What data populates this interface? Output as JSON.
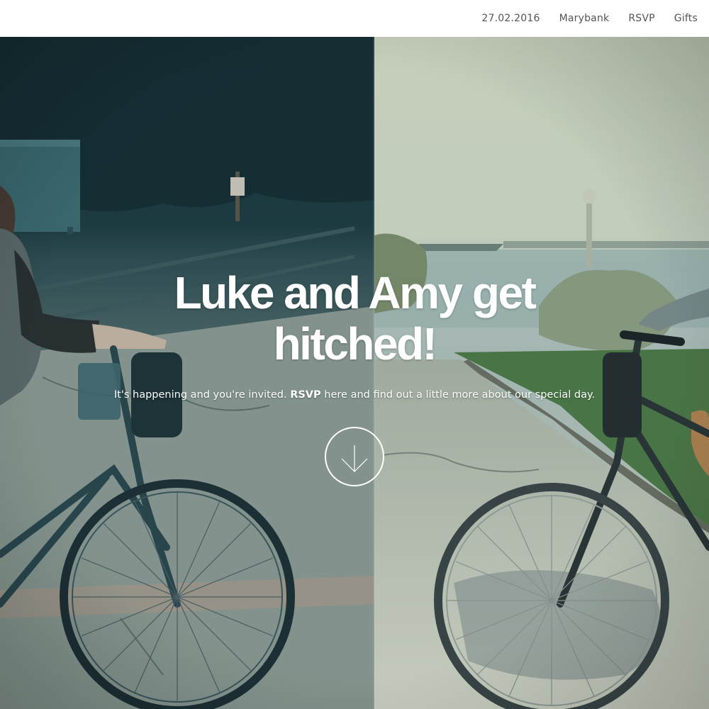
{
  "nav": {
    "items": [
      {
        "label": "27.02.2016"
      },
      {
        "label": "Marybank"
      },
      {
        "label": "RSVP"
      },
      {
        "label": "Gifts"
      }
    ]
  },
  "hero": {
    "title": "Luke and Amy get hitched!",
    "subtitle_before": "It's happening and you're invited. ",
    "subtitle_bold": "RSVP",
    "subtitle_after": " here and find out a little more about our special day.",
    "scroll_icon": "arrow-down-circle-icon"
  },
  "colors": {
    "nav_background": "#ffffff",
    "nav_text": "#555555",
    "hero_text": "#ffffff",
    "photo_left_tint": "#1f3f46",
    "photo_right_tint": "#c9d2b8"
  }
}
